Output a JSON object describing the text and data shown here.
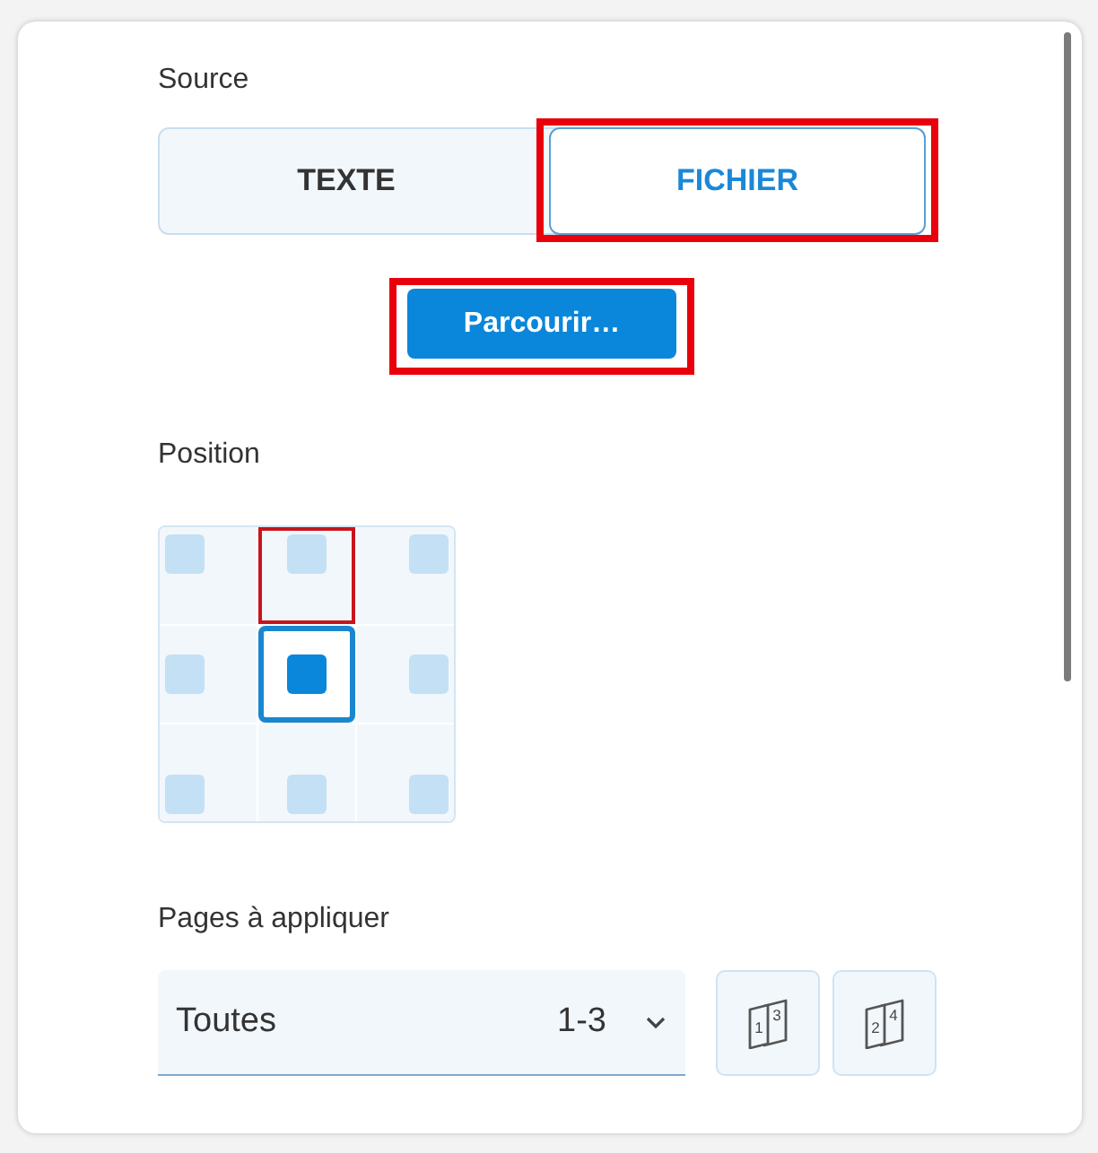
{
  "source": {
    "label": "Source",
    "options": [
      {
        "label": "TEXTE",
        "selected": false,
        "highlighted": false
      },
      {
        "label": "FICHIER",
        "selected": true,
        "highlighted": true
      }
    ],
    "browse_button": {
      "label": "Parcourir…",
      "highlighted": true
    }
  },
  "position": {
    "label": "Position",
    "cells": [
      {
        "selected": false,
        "highlighted": false
      },
      {
        "selected": false,
        "highlighted": true
      },
      {
        "selected": false,
        "highlighted": false
      },
      {
        "selected": false,
        "highlighted": false
      },
      {
        "selected": true,
        "highlighted": false
      },
      {
        "selected": false,
        "highlighted": false
      },
      {
        "selected": false,
        "highlighted": false
      },
      {
        "selected": false,
        "highlighted": false
      },
      {
        "selected": false,
        "highlighted": false
      }
    ]
  },
  "pages": {
    "label": "Pages à appliquer",
    "dropdown": {
      "value": "Toutes",
      "range": "1-3"
    },
    "buttons": [
      {
        "digits": [
          "1",
          "3"
        ]
      },
      {
        "digits": [
          "2",
          "4"
        ]
      }
    ]
  }
}
